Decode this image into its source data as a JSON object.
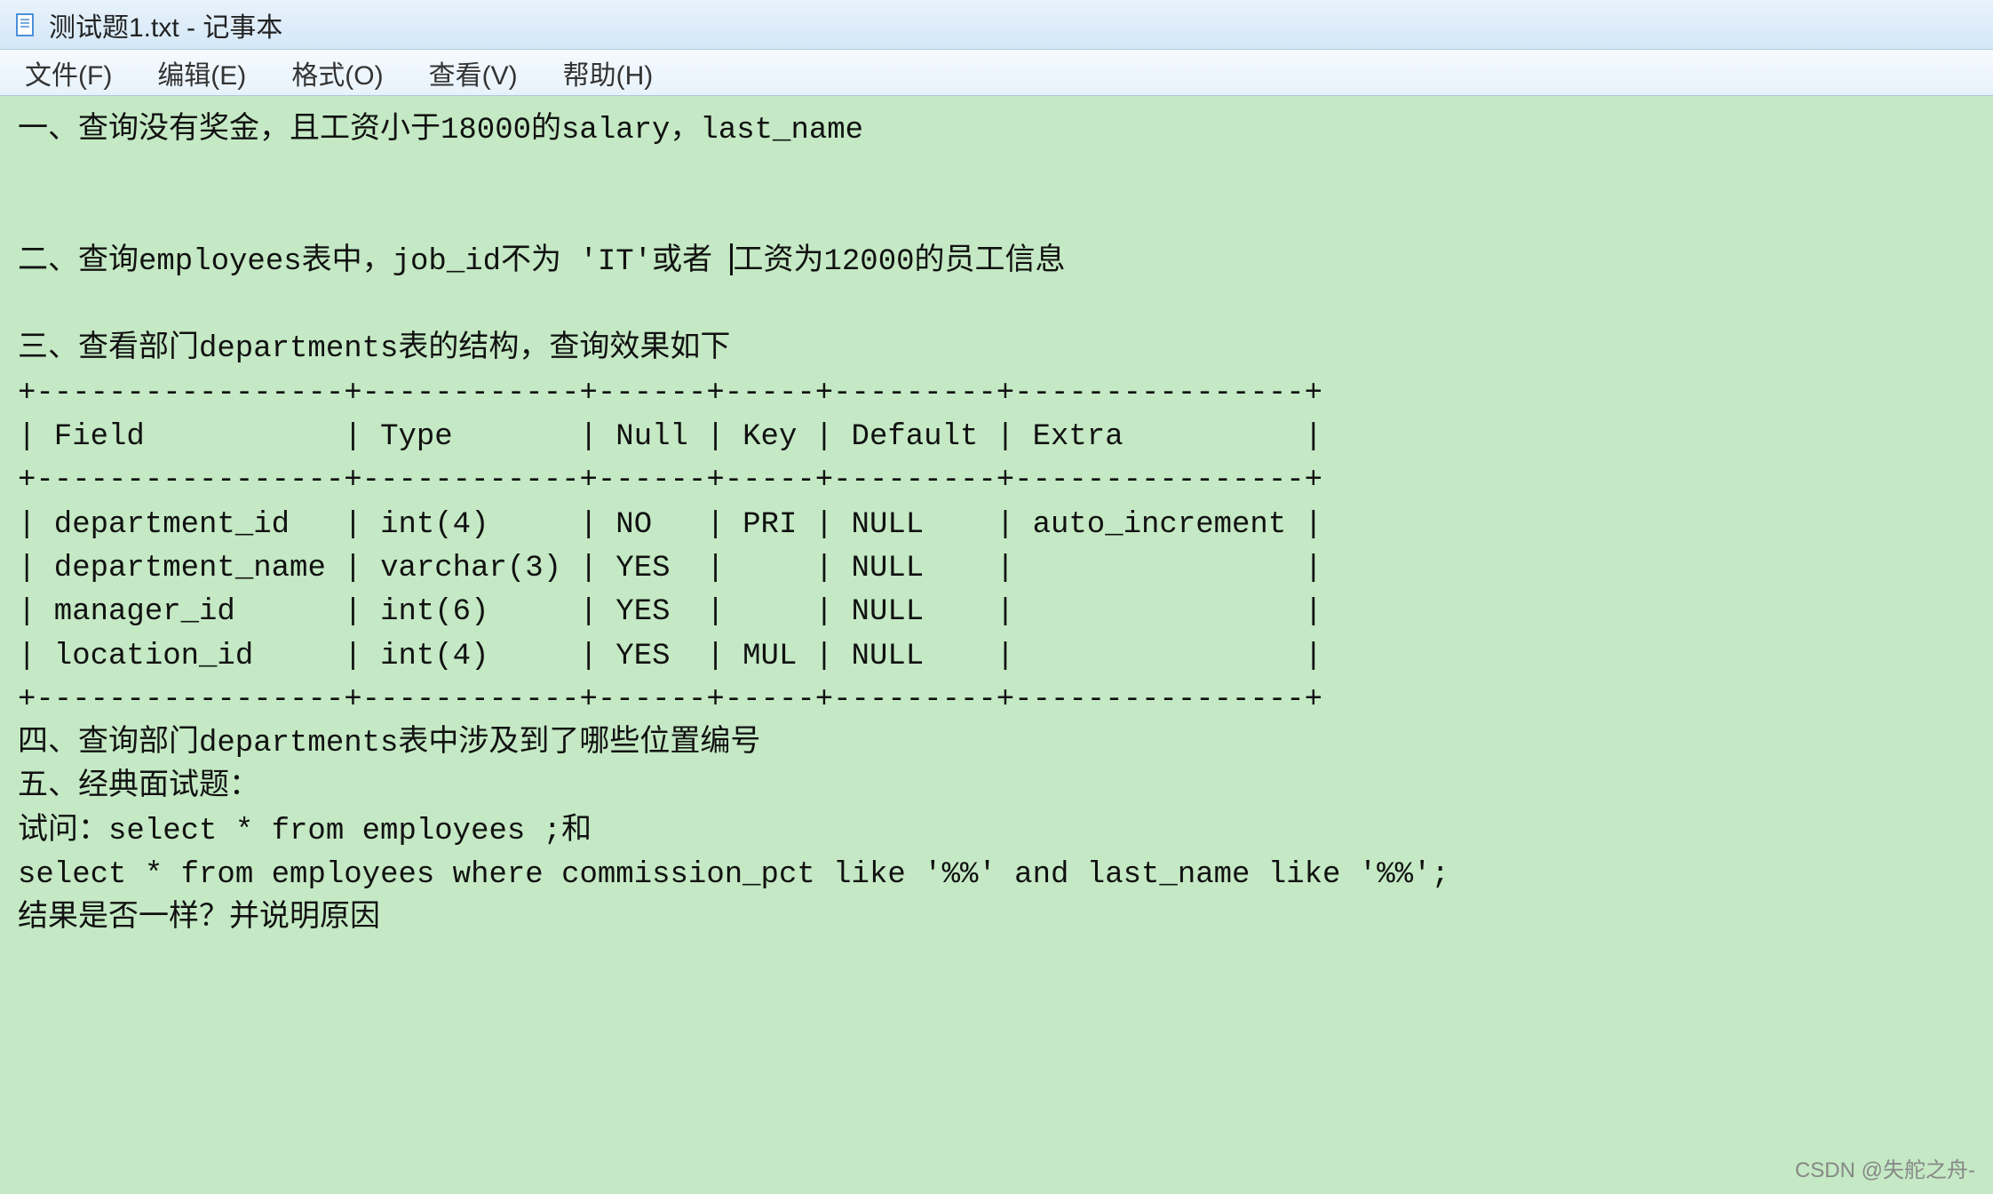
{
  "titlebar": {
    "title": "测试题1.txt - 记事本"
  },
  "menubar": {
    "file": "文件(F)",
    "edit": "编辑(E)",
    "format": "格式(O)",
    "view": "查看(V)",
    "help": "帮助(H)"
  },
  "content": {
    "line1": "一、查询没有奖金，且工资小于18000的salary，last_name",
    "blank1": "",
    "blank2": "",
    "line2a": "二、查询employees表中，job_id不为 'IT'或者 ",
    "line2b": "工资为12000的员工信息",
    "blank3": "",
    "line3": "三、查看部门departments表的结构，查询效果如下",
    "tbl1": "+-----------------+------------+------+-----+---------+----------------+",
    "tbl2": "| Field           | Type       | Null | Key | Default | Extra          |",
    "tbl3": "+-----------------+------------+------+-----+---------+----------------+",
    "tbl4": "| department_id   | int(4)     | NO   | PRI | NULL    | auto_increment |",
    "tbl5": "| department_name | varchar(3) | YES  |     | NULL    |                |",
    "tbl6": "| manager_id      | int(6)     | YES  |     | NULL    |                |",
    "tbl7": "| location_id     | int(4)     | YES  | MUL | NULL    |                |",
    "tbl8": "+-----------------+------------+------+-----+---------+----------------+",
    "line4": "四、查询部门departments表中涉及到了哪些位置编号",
    "line5": "五、经典面试题：",
    "line6": "试问：select * from employees ;和",
    "line7": "select * from employees where commission_pct like '%%' and last_name like '%%';",
    "line8": "结果是否一样？并说明原因"
  },
  "watermark": "CSDN @失舵之舟-"
}
